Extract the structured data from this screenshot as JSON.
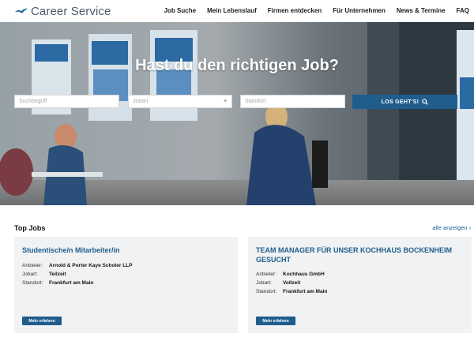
{
  "header": {
    "logo_text": "Career Service",
    "nav": [
      "Job Suche",
      "Mein Lebenslauf",
      "Firmen entdecken",
      "Für Unternehmen",
      "News & Termine",
      "FAQ"
    ]
  },
  "hero": {
    "title": "Hast du den richtigen Job?",
    "search_placeholder": "Suchbegriff",
    "jobart_placeholder": "Jobart",
    "standort_placeholder": "Standort",
    "go_label": "LOS GEHT'S!"
  },
  "top_jobs": {
    "title": "Top Jobs",
    "all_link": "alle anzeigen ›",
    "labels": {
      "anbieter": "Anbieter:",
      "jobart": "Jobart:",
      "standort": "Standort:"
    },
    "button_label": "Mehr erfahren",
    "jobs": [
      {
        "title": "Studentische/n Mitarbeiter/in",
        "anbieter": "Arnold & Porter Kaye Scholer LLP",
        "jobart": "Teilzeit",
        "standort": "Frankfurt am Main"
      },
      {
        "title": "TEAM MANAGER FÜR UNSER KOCHHAUS BOCKENHEIM GESUCHT",
        "anbieter": "Kochhaus GmbH",
        "jobart": "Vollzeit",
        "standort": "Frankfurt am Main"
      }
    ]
  },
  "colors": {
    "accent": "#1f5d8c",
    "card_bg": "#f1f2f3"
  },
  "icons": {
    "logo": "bird-logo-icon",
    "search": "search-icon",
    "dropdown": "chevron-down-icon"
  }
}
